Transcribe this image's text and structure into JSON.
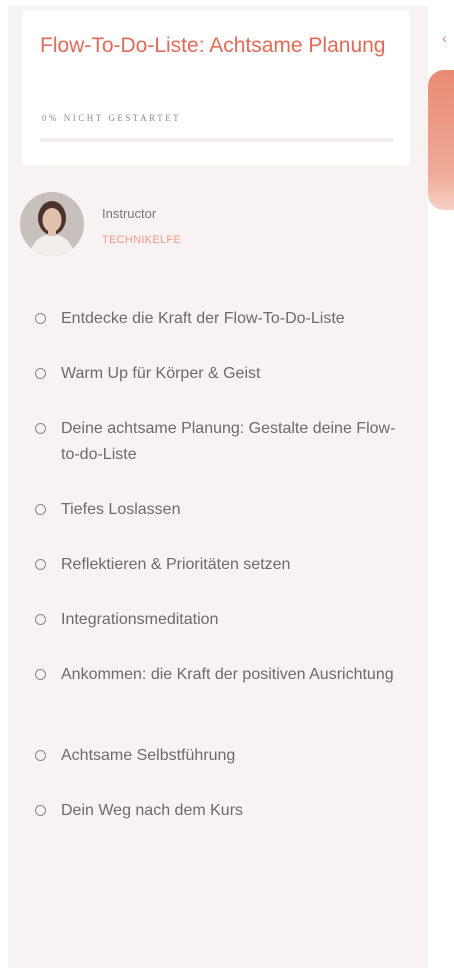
{
  "course": {
    "title": "Flow-To-Do-Liste: Achtsame Planung",
    "progress_status": "0% NICHT GESTARTET",
    "progress_fraction": 0
  },
  "instructor": {
    "label": "Instructor",
    "name": "TECHNIKELFE"
  },
  "lessons": [
    "Entdecke die Kraft der Flow-To-Do-Liste",
    "Warm Up für Körper & Geist",
    "Deine achtsame Planung: Gestalte deine Flow-to-do-Liste",
    "Tiefes Loslassen",
    "Reflektieren & Prioritäten setzen",
    "Integrationsmeditation",
    "Ankommen: die Kraft der positiven Ausrichtung",
    "Achtsame Selbstführung",
    "Dein Weg nach dem Kurs"
  ],
  "right_rail": {
    "icon": "chevron-left-icon"
  },
  "colors": {
    "accent": "#e26a57",
    "sidebar_bg": "#f8f3f2",
    "text": "#6f6a67"
  }
}
